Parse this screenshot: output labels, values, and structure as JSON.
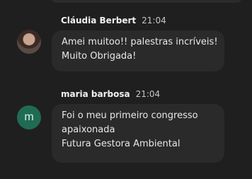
{
  "messages": [
    {
      "avatar_type": "photo",
      "sender": "Cláudia Berbert",
      "time": "21:04",
      "lines": [
        "Amei muitoo!! palestras incríveis!",
        "Muito Obrigada!"
      ]
    },
    {
      "avatar_type": "letter",
      "avatar_letter": "m",
      "sender": "maria barbosa",
      "time": "21:04",
      "lines": [
        "Foi o meu primeiro congresso",
        "apaixonada",
        "Futura Gestora Ambiental"
      ]
    }
  ],
  "colors": {
    "background": "#1f1f1f",
    "bubble": "#2a2a2a",
    "avatar_m": "#1f6b53"
  }
}
